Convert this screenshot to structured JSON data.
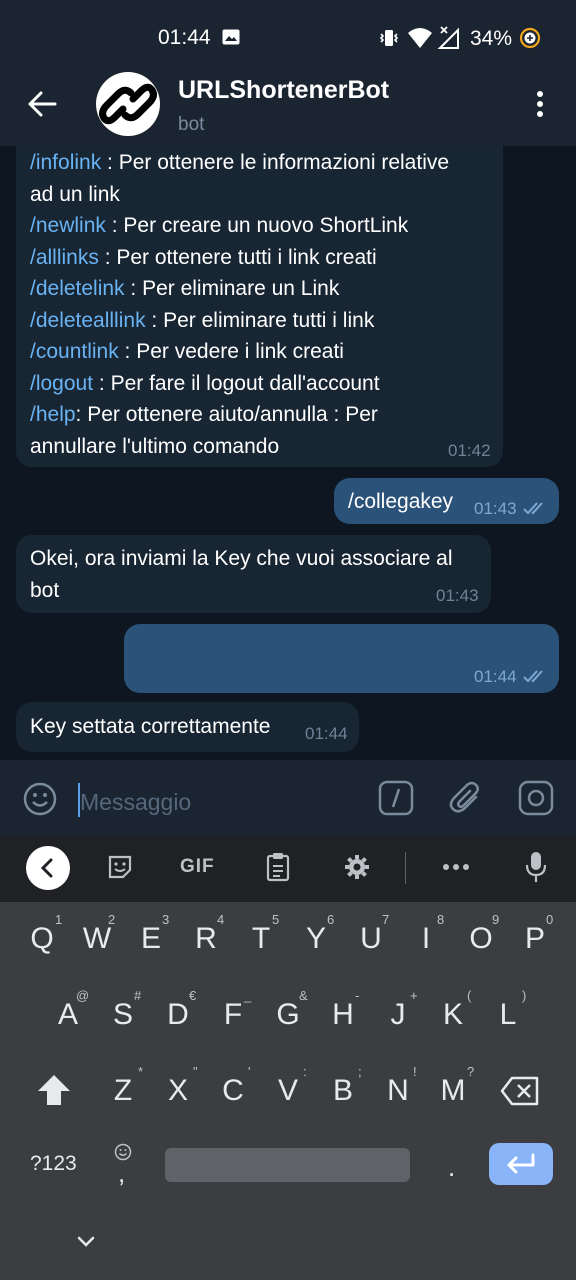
{
  "status_bar": {
    "time": "01:44",
    "battery": "34%",
    "icons": [
      "gallery-icon",
      "vibrate-icon",
      "wifi-icon",
      "signal-icon",
      "battery-saver-icon"
    ]
  },
  "header": {
    "title": "URLShortenerBot",
    "subtitle": "bot"
  },
  "messages": {
    "m1": {
      "lines": [
        {
          "cmd": "/infolink",
          "text": " : Per ottenere le informazioni relative"
        },
        {
          "cmd": "",
          "text": "ad un link"
        },
        {
          "cmd": "/newlink",
          "text": " : Per creare un nuovo ShortLink"
        },
        {
          "cmd": "/alllinks",
          "text": " : Per ottenere tutti i link creati"
        },
        {
          "cmd": "/deletelink",
          "text": " : Per eliminare un Link"
        },
        {
          "cmd": "/deletealllink",
          "text": " : Per eliminare tutti i link"
        },
        {
          "cmd": "/countlink",
          "text": " : Per vedere i link creati"
        },
        {
          "cmd": "/logout",
          "text": " : Per fare il logout dall'account"
        },
        {
          "cmd": "/help",
          "text": ": Per ottenere aiuto/annulla : Per"
        },
        {
          "cmd": "",
          "text": "annullare l'ultimo comando"
        }
      ],
      "time": "01:42"
    },
    "m2": {
      "text": "/collegakey",
      "time": "01:43"
    },
    "m3": {
      "line1": "Okei, ora inviami la Key che vuoi associare al",
      "line2": "bot",
      "time": "01:43"
    },
    "m4": {
      "text": "",
      "time": "01:44"
    },
    "m5": {
      "text": "Key settata correttamente",
      "time": "01:44"
    }
  },
  "input": {
    "placeholder": "Messaggio"
  },
  "keyboard": {
    "toolbar": {
      "gif": "GIF"
    },
    "row1": [
      {
        "k": "Q",
        "h": "1"
      },
      {
        "k": "W",
        "h": "2"
      },
      {
        "k": "E",
        "h": "3"
      },
      {
        "k": "R",
        "h": "4"
      },
      {
        "k": "T",
        "h": "5"
      },
      {
        "k": "Y",
        "h": "6"
      },
      {
        "k": "U",
        "h": "7"
      },
      {
        "k": "I",
        "h": "8"
      },
      {
        "k": "O",
        "h": "9"
      },
      {
        "k": "P",
        "h": "0"
      }
    ],
    "row2": [
      {
        "k": "A",
        "h": "@"
      },
      {
        "k": "S",
        "h": "#"
      },
      {
        "k": "D",
        "h": "€"
      },
      {
        "k": "F",
        "h": "_"
      },
      {
        "k": "G",
        "h": "&"
      },
      {
        "k": "H",
        "h": "-"
      },
      {
        "k": "J",
        "h": "+"
      },
      {
        "k": "K",
        "h": "("
      },
      {
        "k": "L",
        "h": ")"
      }
    ],
    "row3": [
      {
        "k": "Z",
        "h": "*"
      },
      {
        "k": "X",
        "h": "\""
      },
      {
        "k": "C",
        "h": "'"
      },
      {
        "k": "V",
        "h": ":"
      },
      {
        "k": "B",
        "h": ";"
      },
      {
        "k": "N",
        "h": "!"
      },
      {
        "k": "M",
        "h": "?"
      }
    ],
    "sym_label": "?123",
    "comma": ",",
    "period": "."
  }
}
